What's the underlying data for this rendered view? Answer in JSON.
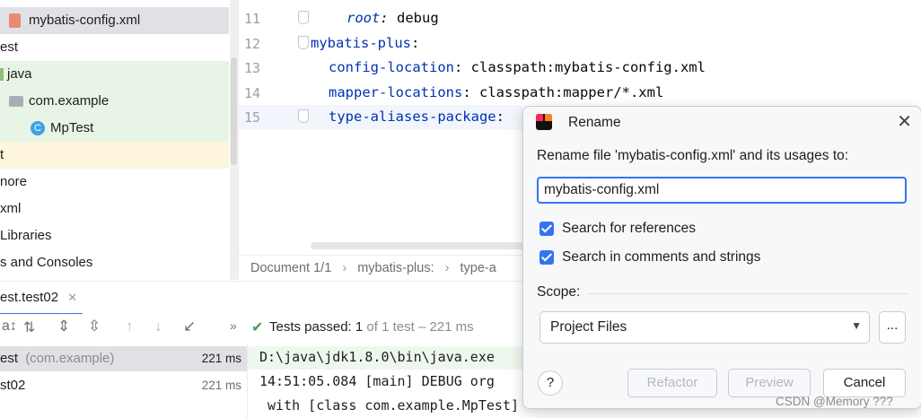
{
  "tree": {
    "items": [
      {
        "label": "mybatis-config.xml"
      },
      {
        "label": "est"
      },
      {
        "label": "java"
      },
      {
        "label": "com.example"
      },
      {
        "label": "MpTest"
      },
      {
        "label": "t"
      },
      {
        "label": "nore"
      },
      {
        "label": "xml"
      },
      {
        "label": "Libraries"
      },
      {
        "label": "s and Consoles"
      }
    ]
  },
  "editor": {
    "line_numbers": [
      "11",
      "12",
      "13",
      "14",
      "15"
    ],
    "lines": [
      {
        "key": "root",
        "sep": ": ",
        "value": "debug"
      },
      {
        "key": "mybatis-plus",
        "sep": ":",
        "value": ""
      },
      {
        "key": "config-location",
        "sep": ": ",
        "value": "classpath:mybatis-config.xml"
      },
      {
        "key": "mapper-locations",
        "sep": ": ",
        "value": "classpath:mapper/*.xml"
      },
      {
        "key": "type-aliases-package",
        "sep": ":",
        "value": ""
      }
    ]
  },
  "breadcrumbs": {
    "doc": "Document 1/1",
    "sep": "›",
    "item1": "mybatis-plus:",
    "item2": "type-a"
  },
  "run": {
    "tab_label": "est.test02",
    "tests_passed_label": "Tests passed:",
    "tests_passed_count": "1",
    "tests_summary": "of 1 test – 221 ms",
    "tests": [
      {
        "name": "est",
        "pkg": "(com.example)",
        "time": "221 ms"
      },
      {
        "name": "st02",
        "pkg": "",
        "time": "221 ms"
      }
    ],
    "console_lines": [
      "D:\\java\\jdk1.8.0\\bin\\java.exe",
      "14:51:05.084 [main] DEBUG org",
      " with [class com.example.MpTest]"
    ]
  },
  "dialog": {
    "title": "Rename",
    "prompt": "Rename file 'mybatis-config.xml' and its usages to:",
    "input_value": "mybatis-config.xml",
    "search_refs_label": "Search for references",
    "search_comments_label": "Search in comments and strings",
    "scope_label": "Scope:",
    "scope_value": "Project Files",
    "more_button": "...",
    "help_button": "?",
    "refactor_button": "Refactor",
    "preview_button": "Preview",
    "cancel_button": "Cancel",
    "search_refs_checked": true,
    "search_comments_checked": true
  },
  "watermark": "CSDN @Memory ???",
  "colors": {
    "accent": "#3574f0",
    "success": "#499c54",
    "tree_selected": "#dfe1e5",
    "tree_test_bg": "#e8f4e6",
    "tree_out_bg": "#fdf5dc",
    "console_success_bg": "#edf7ed"
  }
}
